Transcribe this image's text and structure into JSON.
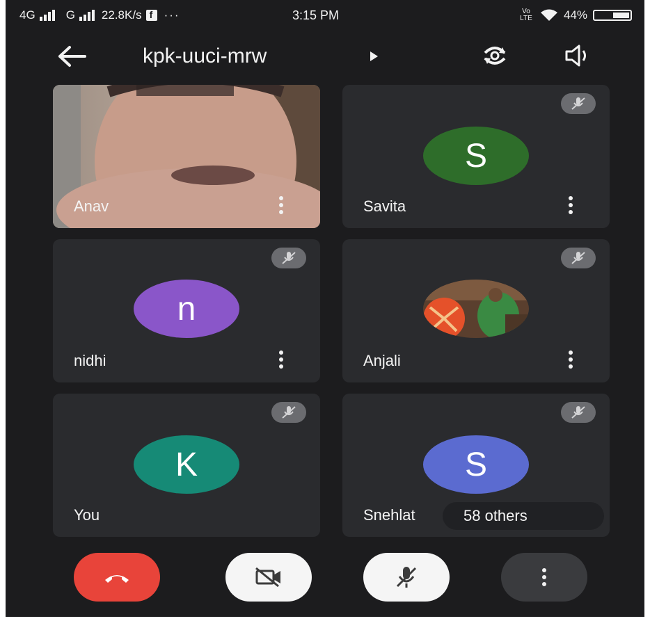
{
  "status_bar": {
    "network": "4G",
    "network2": "G",
    "speed": "22.8K/s",
    "ellipsis": "···",
    "time": "3:15 PM",
    "volte": "Vo LTE",
    "battery": "44%",
    "battery_level": 0.44
  },
  "header": {
    "meeting_code": "kpk-uuci-mrw"
  },
  "tiles": [
    {
      "name": "Anav",
      "type": "video"
    },
    {
      "name": "Savita",
      "initial": "S",
      "avatar_color": "#2e6d2a",
      "muted": true
    },
    {
      "name": "nidhi",
      "initial": "n",
      "avatar_color": "#8a56c9",
      "muted": true
    },
    {
      "name": "Anjali",
      "type": "photo",
      "muted": true
    },
    {
      "name": "You",
      "initial": "K",
      "avatar_color": "#168a76",
      "muted": true
    },
    {
      "name": "Snehlat",
      "initial": "S",
      "avatar_color": "#5b6bd0",
      "muted": true
    }
  ],
  "others_pill": "58 others",
  "controls": {
    "end_call_color": "#e8443a",
    "camera_button_color": "#f5f5f5",
    "mic_button_color": "#f5f5f5",
    "more_button_color": "#3a3b3e"
  }
}
